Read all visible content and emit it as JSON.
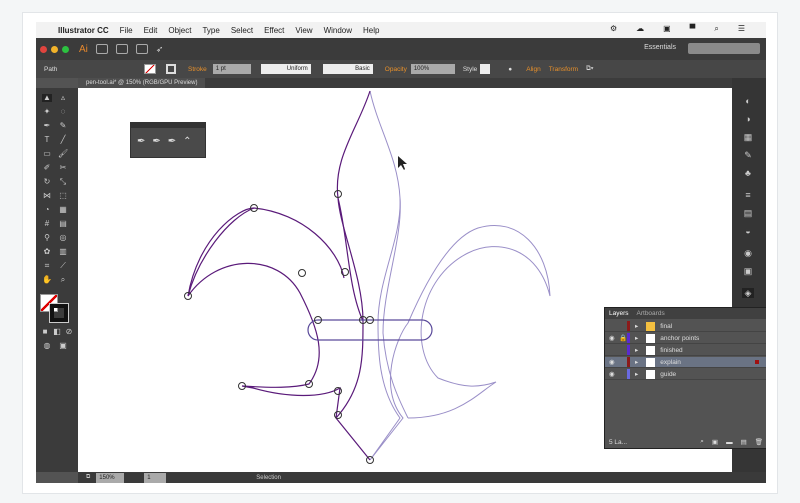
{
  "menubar": {
    "app": "Illustrator CC",
    "items": [
      "File",
      "Edit",
      "Object",
      "Type",
      "Select",
      "Effect",
      "View",
      "Window",
      "Help"
    ]
  },
  "appbar": {
    "logo": "Ai",
    "workspace": "Essentials",
    "colors": {
      "close": "#e0443e",
      "min": "#f2b32a",
      "max": "#2cc140",
      "accent": "#e5872c"
    }
  },
  "control": {
    "selection": "Path",
    "stroke_label": "Stroke",
    "stroke_value": "1 pt",
    "profile": "Uniform",
    "brush": "Basic",
    "opacity_label": "Opacity",
    "opacity_value": "100%",
    "style_label": "Style",
    "align": "Align",
    "transform": "Transform"
  },
  "document": {
    "tab": "pen-tool.ai* @ 150% (RGB/GPU Preview)"
  },
  "layers": {
    "tabs": [
      "Layers",
      "Artboards"
    ],
    "rows": [
      {
        "name": "final",
        "color": "#8b1a1a",
        "visible": false,
        "locked": false,
        "selected": false
      },
      {
        "name": "anchor points",
        "color": "#5a2bd0",
        "visible": true,
        "locked": true,
        "selected": false
      },
      {
        "name": "finished",
        "color": "#5a2bd0",
        "visible": false,
        "locked": false,
        "selected": false
      },
      {
        "name": "explain",
        "color": "#8b1a1a",
        "visible": true,
        "locked": false,
        "selected": true
      },
      {
        "name": "guide",
        "color": "#6a6ae0",
        "visible": true,
        "locked": false,
        "selected": false
      }
    ],
    "count": "5 La..."
  },
  "status": {
    "zoom": "150%",
    "page": "1",
    "tool": "Selection"
  }
}
